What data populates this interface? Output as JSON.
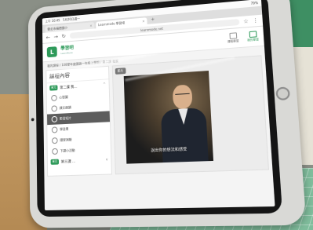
{
  "status_bar": {
    "left": "上午 10:45",
    "date": "5月20日週一",
    "right": "79%"
  },
  "tabs": [
    {
      "label": "雲北市福德國小"
    },
    {
      "label": "Learnmode 學習吧"
    }
  ],
  "address": {
    "url": "learnmode.net"
  },
  "site": {
    "logo_text": "學習吧",
    "logo_sub": "LearnMode",
    "nav": [
      {
        "label": "課程學習"
      },
      {
        "label": "我的學習"
      }
    ]
  },
  "breadcrumb": "我的課程 / 108學年度國語一年級上學期 / 第二課 我家",
  "sidebar": {
    "title": "課程內容",
    "chapter": {
      "pill": "單元",
      "label": "第二課 我..."
    },
    "items": [
      {
        "label": "心智圖"
      },
      {
        "label": "課文朗讀"
      },
      {
        "label": "影音短片"
      },
      {
        "label": "學習單"
      },
      {
        "label": "隨堂測驗"
      },
      {
        "label": "下課小活動"
      }
    ],
    "chapter2": {
      "pill": "單元",
      "label": "第三課 ..."
    }
  },
  "content": {
    "tag": "影片",
    "subtitle": "說出你的想法和感受"
  },
  "colors": {
    "brand_green": "#2e9a5a"
  }
}
